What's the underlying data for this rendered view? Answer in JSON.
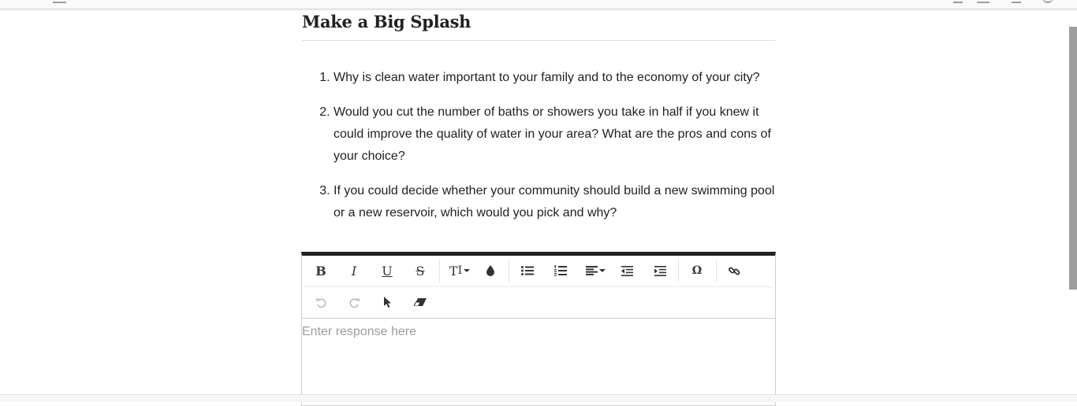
{
  "page": {
    "title": "Make a Big Splash"
  },
  "questions": [
    "Why is clean water important to your family and to the economy of your city?",
    "Would you cut the number of baths or showers you take in half if you knew it could improve the quality of water in your area? What are the pros and cons of your choice?",
    "If you could decide whether your community should build a new swimming pool or a new reservoir, which would you pick and why?"
  ],
  "editor": {
    "placeholder": "Enter response here",
    "toolbar": {
      "bold": "B",
      "italic": "I",
      "underline": "U",
      "strikethrough": "S",
      "font_size": "T",
      "special_char": "Ω"
    }
  },
  "colors": {
    "title_text": "#212121",
    "editor_top_border": "#212121",
    "placeholder": "#9e9e9e",
    "scrollbar": "#9e9e9e"
  }
}
